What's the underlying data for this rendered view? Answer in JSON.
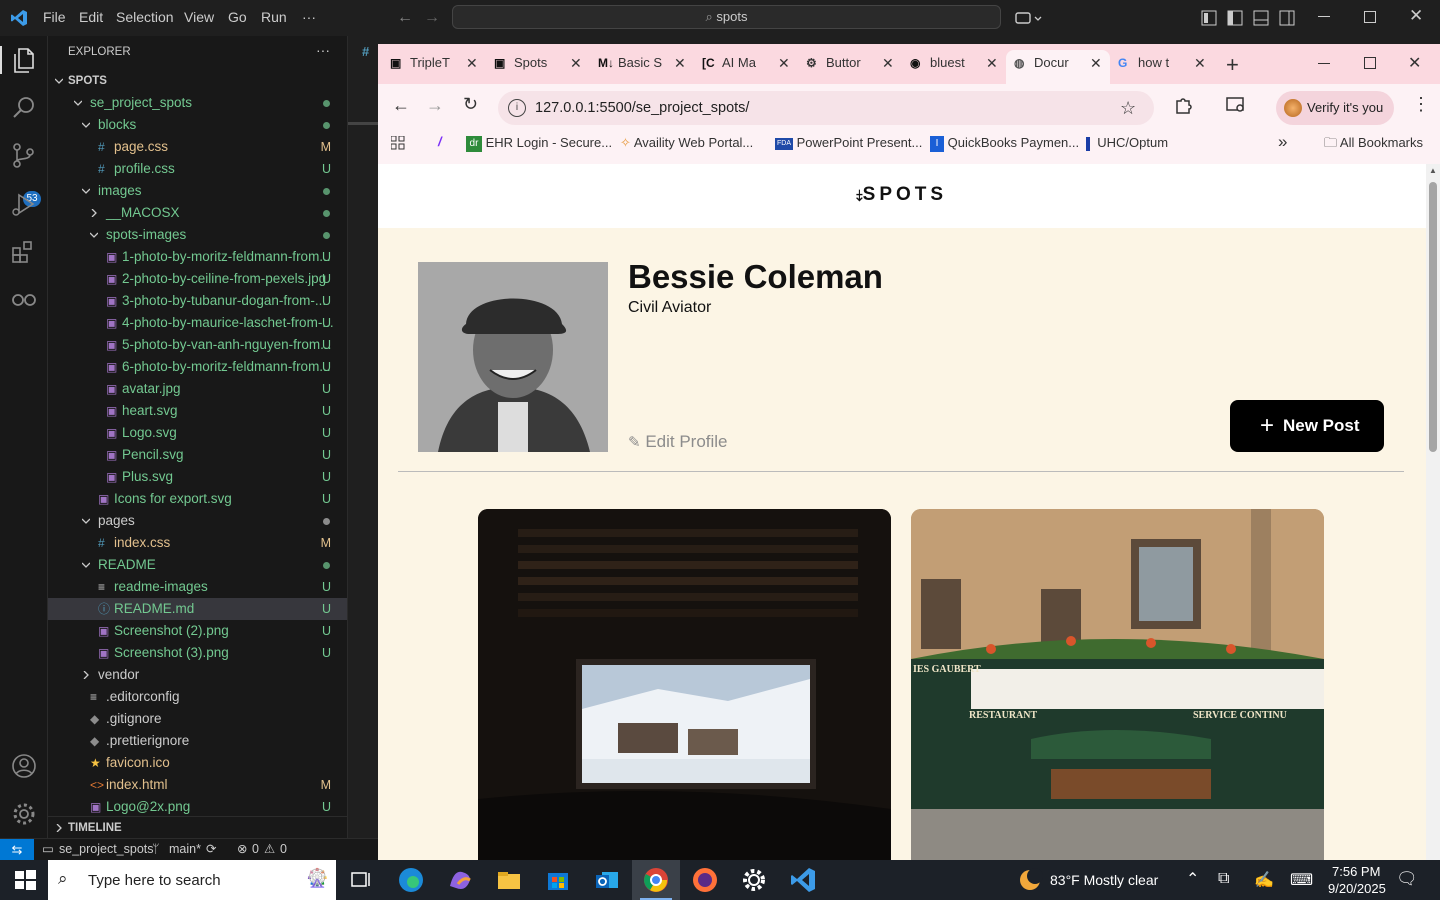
{
  "vscode": {
    "menu": [
      "File",
      "Edit",
      "Selection",
      "View",
      "Go",
      "Run",
      "···"
    ],
    "search": "spots",
    "scm_badge": "53",
    "explorer_title": "EXPLORER",
    "explorer_more": "···",
    "section_spots": "SPOTS",
    "section_timeline": "TIMELINE",
    "tree": [
      {
        "name": "se_project_spots",
        "status": "dot-green",
        "kind": "folder-open",
        "depth": 0
      },
      {
        "name": "blocks",
        "status": "dot-green",
        "kind": "folder-open",
        "depth": 1
      },
      {
        "name": "page.css",
        "status": "M",
        "kind": "css",
        "depth": 2
      },
      {
        "name": "profile.css",
        "status": "U",
        "kind": "css",
        "depth": 2
      },
      {
        "name": "images",
        "status": "dot-green",
        "kind": "folder-open",
        "depth": 1
      },
      {
        "name": "__MACOSX",
        "status": "dot-green",
        "kind": "folder-closed",
        "depth": 2
      },
      {
        "name": "spots-images",
        "status": "dot-green",
        "kind": "folder-open",
        "depth": 2
      },
      {
        "name": "1-photo-by-moritz-feldmann-from...",
        "status": "U",
        "kind": "img",
        "depth": 3
      },
      {
        "name": "2-photo-by-ceiline-from-pexels.jpg",
        "status": "U",
        "kind": "img",
        "depth": 3
      },
      {
        "name": "3-photo-by-tubanur-dogan-from-...",
        "status": "U",
        "kind": "img",
        "depth": 3
      },
      {
        "name": "4-photo-by-maurice-laschet-from-...",
        "status": "U",
        "kind": "img",
        "depth": 3
      },
      {
        "name": "5-photo-by-van-anh-nguyen-from...",
        "status": "U",
        "kind": "img",
        "depth": 3
      },
      {
        "name": "6-photo-by-moritz-feldmann-from...",
        "status": "U",
        "kind": "img",
        "depth": 3
      },
      {
        "name": "avatar.jpg",
        "status": "U",
        "kind": "img",
        "depth": 3
      },
      {
        "name": "heart.svg",
        "status": "U",
        "kind": "img",
        "depth": 3
      },
      {
        "name": "Logo.svg",
        "status": "U",
        "kind": "img",
        "depth": 3
      },
      {
        "name": "Pencil.svg",
        "status": "U",
        "kind": "img",
        "depth": 3
      },
      {
        "name": "Plus.svg",
        "status": "U",
        "kind": "img",
        "depth": 3
      },
      {
        "name": "Icons for export.svg",
        "status": "U",
        "kind": "img",
        "depth": 2
      },
      {
        "name": "pages",
        "status": "dot-grey",
        "kind": "folder-open",
        "depth": 1
      },
      {
        "name": "index.css",
        "status": "M",
        "kind": "css",
        "depth": 2
      },
      {
        "name": "README",
        "status": "dot-green",
        "kind": "folder-open",
        "depth": 1
      },
      {
        "name": "readme-images",
        "status": "U",
        "kind": "txt",
        "depth": 2
      },
      {
        "name": "README.md",
        "status": "U",
        "kind": "info",
        "depth": 2
      },
      {
        "name": "Screenshot (2).png",
        "status": "U",
        "kind": "img",
        "depth": 2
      },
      {
        "name": "Screenshot (3).png",
        "status": "U",
        "kind": "img",
        "depth": 2
      },
      {
        "name": "vendor",
        "status": "",
        "kind": "folder-closed",
        "depth": 1
      },
      {
        "name": ".editorconfig",
        "status": "",
        "kind": "txt",
        "depth": 1
      },
      {
        "name": ".gitignore",
        "status": "",
        "kind": "git",
        "depth": 1
      },
      {
        "name": ".prettierignore",
        "status": "",
        "kind": "git",
        "depth": 1
      },
      {
        "name": "favicon.ico",
        "status": "",
        "kind": "star",
        "depth": 1
      },
      {
        "name": "index.html",
        "status": "M",
        "kind": "html",
        "depth": 1
      },
      {
        "name": "Logo@2x.png",
        "status": "U",
        "kind": "img",
        "depth": 1
      }
    ],
    "statusbar": {
      "folder": "se_project_spots",
      "branch": "main*",
      "errors": "0",
      "warnings": "0"
    }
  },
  "chrome": {
    "tabs": [
      "TripleT",
      "Spots",
      "Basic S",
      "AI Ma",
      "Buttor",
      "bluest",
      "Docur",
      "how t"
    ],
    "active_tab": 6,
    "new_tab": "+",
    "url": "127.0.0.1:5500/se_project_spots/",
    "verify": "Verify it's you",
    "bookmarks": [
      "EHR Login - Secure...",
      "Availity Web Portal...",
      "PowerPoint Present...",
      "QuickBooks Paymen...",
      "UHC/Optum"
    ],
    "more_bookmarks": "»",
    "all_bookmarks": "All Bookmarks"
  },
  "page": {
    "logo": "SPOTS",
    "name": "Bessie Coleman",
    "job": "Civil Aviator",
    "edit": "Edit Profile",
    "new_post": "New Post",
    "cafe_sign_left": "RESTAURANT",
    "cafe_sign_right": "SERVICE CONTINU",
    "cafe_name": "IES GAUBERT"
  },
  "taskbar": {
    "search": "Type here to search",
    "weather": "83°F  Mostly clear",
    "time": "7:56 PM",
    "date": "9/20/2025"
  },
  "colors": {
    "accent_green": "#73c991",
    "accent_mod": "#e2c08d",
    "chrome_pink": "#fbd9e0",
    "page_bg": "#fcf5e5"
  }
}
